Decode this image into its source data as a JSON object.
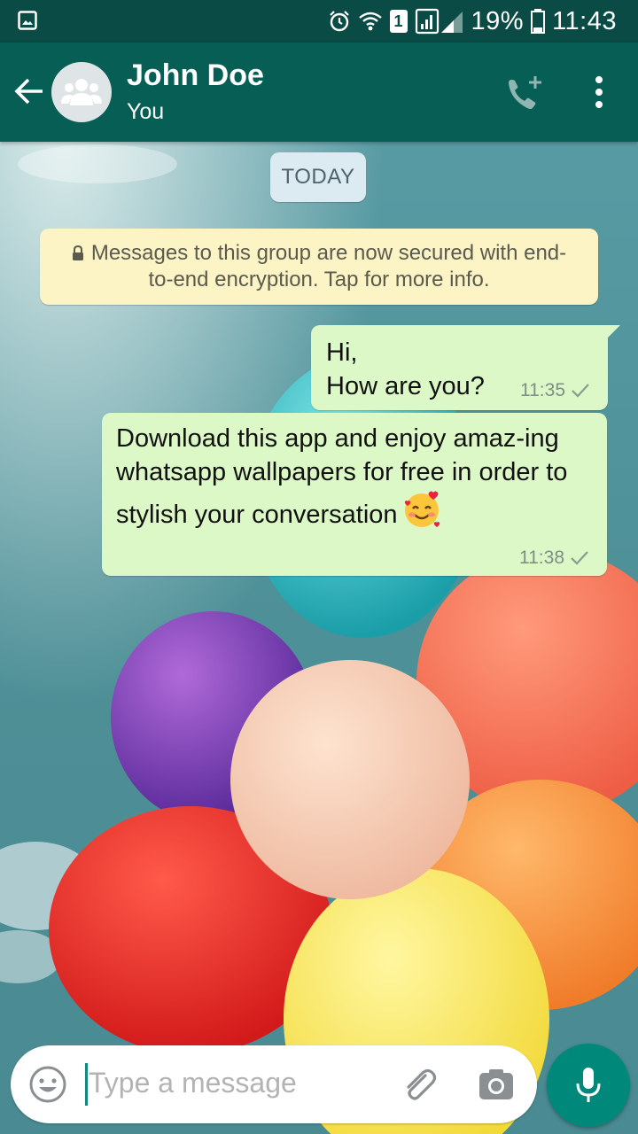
{
  "status_bar": {
    "battery": "19%",
    "time": "11:43",
    "sim_slot": "1",
    "icons": [
      "gallery-icon",
      "alarm-icon",
      "wifi-icon",
      "sim-icon",
      "signal-icon",
      "battery-icon"
    ]
  },
  "header": {
    "contact_name": "John Doe",
    "subtitle": "You",
    "icons": [
      "back-arrow-icon",
      "group-avatar-icon",
      "add-call-icon",
      "more-vert-icon"
    ]
  },
  "chat": {
    "date_chip": "TODAY",
    "encryption_notice": "Messages to this group are now secured with end-to-end encryption. Tap for more info.",
    "messages": [
      {
        "text": "Hi,\nHow are you?",
        "time": "11:35",
        "status": "sent"
      },
      {
        "text": "Download this app and enjoy amaz-ing whatsapp wallpapers for free in order to stylish your conversation",
        "emoji": "smiling-face-with-hearts",
        "time": "11:38",
        "status": "sent"
      }
    ]
  },
  "composer": {
    "placeholder": "Type a message",
    "icons": [
      "emoji-icon",
      "attach-icon",
      "camera-icon",
      "mic-icon"
    ]
  },
  "colors": {
    "status_bar": "#0b4b45",
    "app_bar": "#075e54",
    "outgoing_bubble": "#dcf8c6",
    "notice_bg": "#fcf4c4",
    "date_chip_bg": "#dcebf2",
    "mic_button": "#00897b"
  }
}
